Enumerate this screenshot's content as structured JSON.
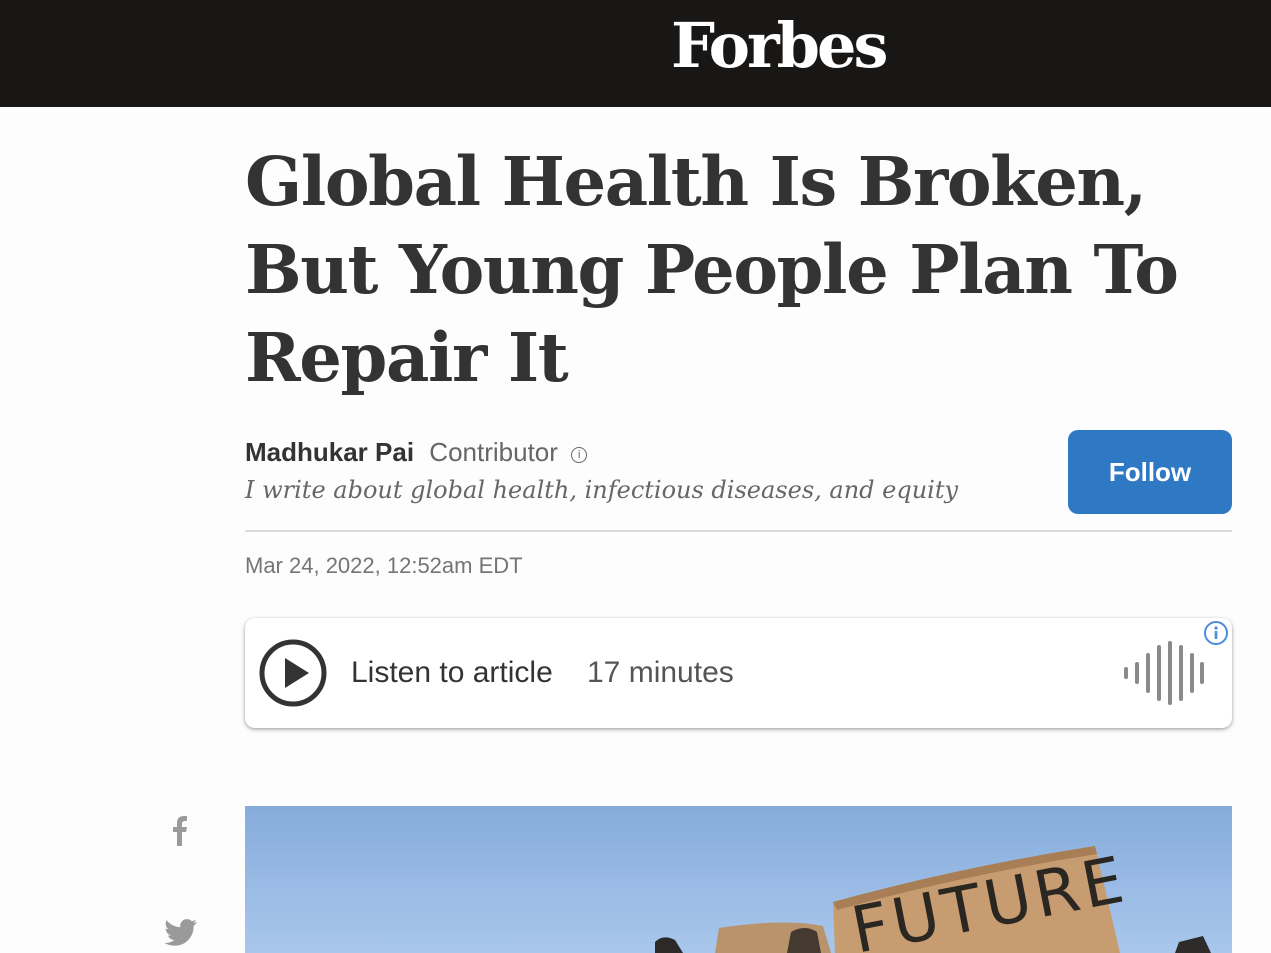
{
  "header": {
    "logo_text": "Forbes"
  },
  "article": {
    "title": "Global Health Is Broken, But Young People Plan To Repair It",
    "author": {
      "name": "Madhukar Pai",
      "role": "Contributor",
      "tagline": "I write about global health, infectious diseases, and equity"
    },
    "follow_label": "Follow",
    "date": "Mar 24, 2022, 12:52am EDT"
  },
  "audio": {
    "label": "Listen to article",
    "duration": "17 minutes"
  },
  "hero_image": {
    "sign_text": "FUTURE"
  },
  "share": {
    "facebook_icon": "facebook-icon",
    "twitter_icon": "twitter-icon"
  },
  "colors": {
    "header_bg": "#181716",
    "follow_button": "#2f78c4",
    "headline_text": "#333333"
  }
}
